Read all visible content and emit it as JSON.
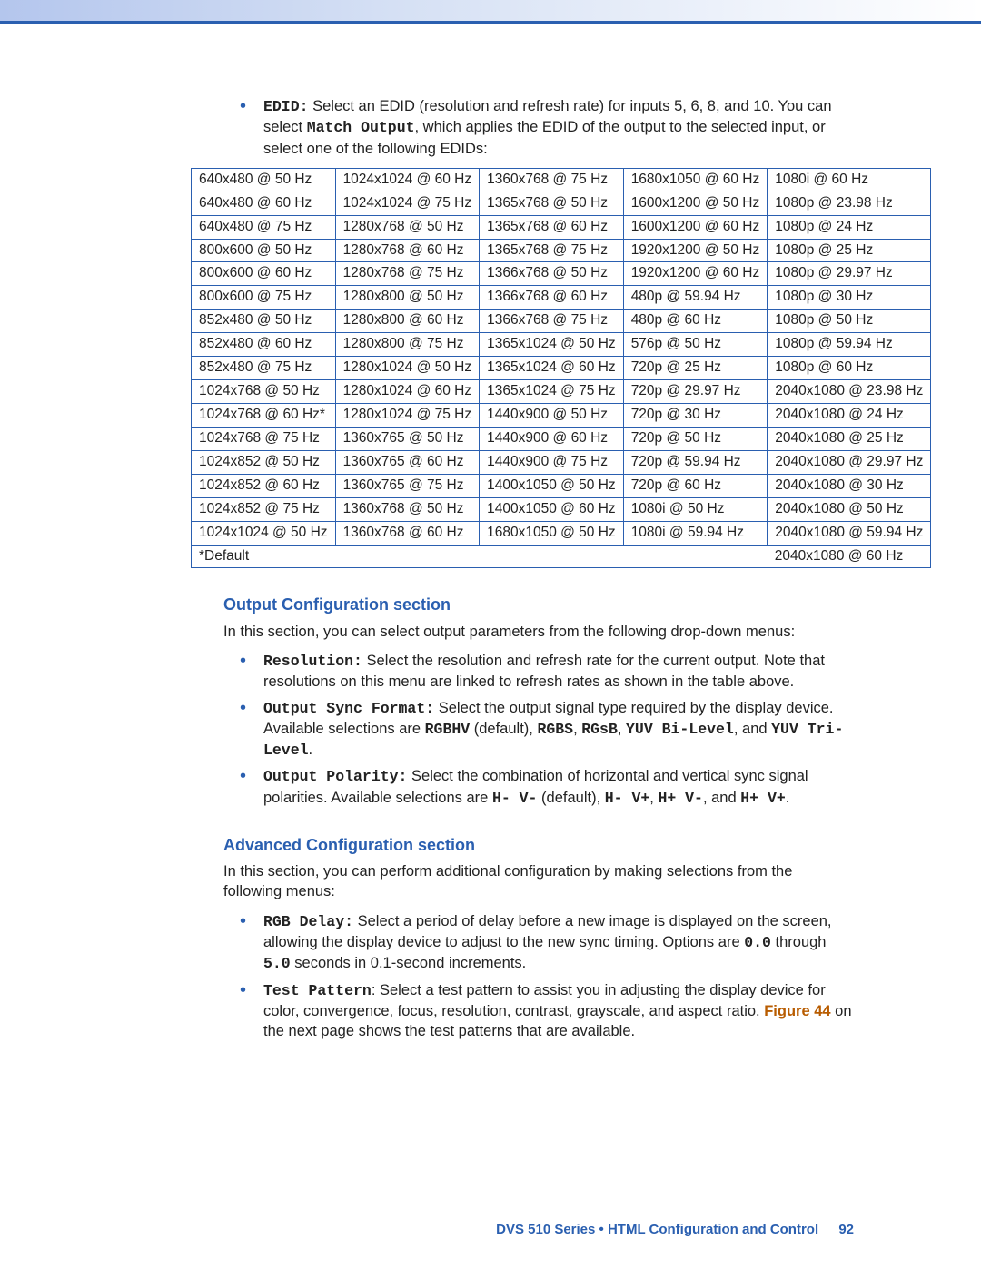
{
  "edid_intro": {
    "label": "EDID:",
    "text_before_tt": " Select an EDID (resolution and refresh rate) for inputs 5, 6, 8, and 10. You can select ",
    "tt": "Match Output",
    "text_after_tt": ", which applies the EDID of the output to the selected input, or select one of the following EDIDs:"
  },
  "edid_table": {
    "rows": [
      [
        "640x480 @ 50 Hz",
        "1024x1024 @ 60 Hz",
        "1360x768 @ 75 Hz",
        "1680x1050 @ 60 Hz",
        "1080i @ 60 Hz"
      ],
      [
        "640x480 @ 60 Hz",
        "1024x1024 @ 75 Hz",
        "1365x768 @ 50 Hz",
        "1600x1200 @ 50 Hz",
        "1080p @ 23.98 Hz"
      ],
      [
        "640x480 @ 75 Hz",
        "1280x768 @ 50 Hz",
        "1365x768 @ 60 Hz",
        "1600x1200 @ 60 Hz",
        "1080p @ 24 Hz"
      ],
      [
        "800x600 @ 50 Hz",
        "1280x768 @ 60 Hz",
        "1365x768 @ 75 Hz",
        "1920x1200 @ 50 Hz",
        "1080p @ 25 Hz"
      ],
      [
        "800x600 @ 60 Hz",
        "1280x768 @ 75 Hz",
        "1366x768 @ 50 Hz",
        "1920x1200 @ 60 Hz",
        "1080p @ 29.97 Hz"
      ],
      [
        "800x600 @ 75 Hz",
        "1280x800 @ 50 Hz",
        "1366x768 @ 60 Hz",
        "480p @ 59.94 Hz",
        "1080p @ 30 Hz"
      ],
      [
        "852x480 @ 50 Hz",
        "1280x800 @ 60 Hz",
        "1366x768 @ 75 Hz",
        "480p @ 60 Hz",
        "1080p @ 50 Hz"
      ],
      [
        "852x480 @ 60 Hz",
        "1280x800 @ 75 Hz",
        "1365x1024 @ 50 Hz",
        "576p @ 50 Hz",
        "1080p @ 59.94 Hz"
      ],
      [
        "852x480 @ 75 Hz",
        "1280x1024 @ 50 Hz",
        "1365x1024 @ 60 Hz",
        "720p @ 25 Hz",
        "1080p @ 60 Hz"
      ],
      [
        "1024x768 @ 50 Hz",
        "1280x1024 @ 60 Hz",
        "1365x1024 @ 75 Hz",
        "720p @ 29.97 Hz",
        "2040x1080 @ 23.98 Hz"
      ],
      [
        "1024x768 @ 60 Hz*",
        "1280x1024 @ 75 Hz",
        "1440x900 @ 50 Hz",
        "720p @ 30 Hz",
        "2040x1080 @ 24 Hz"
      ],
      [
        "1024x768 @ 75 Hz",
        "1360x765 @ 50 Hz",
        "1440x900 @ 60 Hz",
        "720p @ 50 Hz",
        "2040x1080 @ 25 Hz"
      ],
      [
        "1024x852 @ 50 Hz",
        "1360x765 @ 60 Hz",
        "1440x900 @ 75 Hz",
        "720p @ 59.94 Hz",
        "2040x1080 @ 29.97 Hz"
      ],
      [
        "1024x852 @ 60 Hz",
        "1360x765 @ 75 Hz",
        "1400x1050 @ 50 Hz",
        "720p @ 60 Hz",
        "2040x1080 @ 30 Hz"
      ],
      [
        "1024x852 @ 75 Hz",
        "1360x768 @ 50 Hz",
        "1400x1050 @ 60 Hz",
        "1080i @ 50 Hz",
        "2040x1080 @ 50 Hz"
      ],
      [
        "1024x1024 @ 50 Hz",
        "1360x768 @ 60 Hz",
        "1680x1050 @ 50 Hz",
        "1080i @ 59.94 Hz",
        "2040x1080 @ 59.94 Hz"
      ],
      [
        "*Default",
        "",
        "",
        "",
        "2040x1080 @ 60 Hz"
      ]
    ]
  },
  "output_section": {
    "heading": "Output Configuration section",
    "intro": "In this section, you can select output parameters from the following drop-down menus:",
    "items": {
      "resolution": {
        "label": "Resolution:",
        "text": " Select the resolution and refresh rate for the current output. Note that resolutions on this menu are linked to refresh rates as shown in the table above."
      },
      "sync": {
        "label": "Output Sync Format:",
        "t1": " Select the output signal type required by the display device. Available selections are ",
        "opt1": "RGBHV",
        "t2": " (default), ",
        "opt2": "RGBS",
        "t3": ", ",
        "opt3": "RGsB",
        "t4": ", ",
        "opt4": "YUV Bi-Level",
        "t5": ", and ",
        "opt5": "YUV Tri-Level",
        "t6": "."
      },
      "polarity": {
        "label": "Output Polarity:",
        "t1": " Select the combination of horizontal and vertical sync signal polarities. Available selections are ",
        "opt1": "H- V-",
        "t2": " (default), ",
        "opt2": "H- V+",
        "t3": ", ",
        "opt3": "H+ V-",
        "t4": ", and ",
        "opt4": "H+ V+",
        "t5": "."
      }
    }
  },
  "advanced_section": {
    "heading": "Advanced Configuration section",
    "intro": "In this section, you can perform additional configuration by making selections from the following menus:",
    "items": {
      "rgbdelay": {
        "label": "RGB Delay:",
        "t1": " Select a period of delay before a new image is displayed on the screen, allowing the display device to adjust to the new sync timing. Options are ",
        "opt1": "0.0",
        "t2": " through ",
        "opt2": "5.0",
        "t3": " seconds in 0.1-second increments."
      },
      "testpattern": {
        "label": "Test Pattern",
        "t1": ": Select a test pattern to assist you in adjusting the display device for color, convergence, focus, resolution, contrast, grayscale, and aspect ratio. ",
        "figref": "Figure 44",
        "t2": " on the next page shows the test patterns that are available."
      }
    }
  },
  "footer": {
    "text": "DVS 510 Series • HTML Configuration and Control",
    "page": "92"
  }
}
